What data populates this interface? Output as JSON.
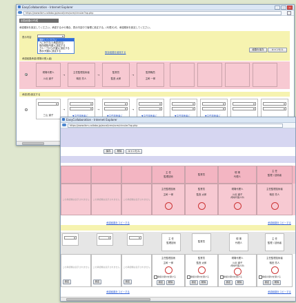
{
  "back_window": {
    "title": "EasyCollaboration - Internet Explorer",
    "url": "https://www.ibm-collabo.jp/ascal/cms/scm/circular?ap.php",
    "section_title": "回覧経路の作成",
    "instruction": "承認順序を設定してください。承認するかの場合、表示内容中で管理に設定する。(代理)も可。承認順序を設定してください。",
    "row_label": "表示内容",
    "dropdown_options": [
      "選択してください",
      "人に対する(1)承認(担当)",
      "既存経路(代替)に設定する",
      "グループから(代替)に設定する",
      "表示(代替)に設定する"
    ],
    "link_existing": "既存経路を使用する",
    "link_copy": "回覧経路を保存(登録)",
    "btn_save": "経路を保存",
    "btn_cancel": "キャンセル",
    "route_header": "承認経路承認(現場の受入者)",
    "route_cells": [
      {
        "line1": "現場代理人",
        "line2": "川北 道子"
      },
      {
        "line1": "主任監理技術者",
        "line2": "鴨田 芳人"
      },
      {
        "line1": "監督員",
        "line2": "監査 太郎"
      },
      {
        "line1": "監督職員",
        "line2": "主幹 一郎"
      }
    ],
    "lower_header": "承認(受)設定する",
    "lower_name": "三山 道子",
    "lower_links": [
      "▼主任技術者に",
      "▼主任技術者に",
      "▼主任技術者に",
      "▼主任技術者に",
      "▼主任技術者に"
    ]
  },
  "front_window": {
    "title": "EasyCollaboration - Internet Explorer",
    "url": "https://www.ibm-collabo.jp/ascal/cms/scm/circular?ap.php",
    "btn_save": "保存",
    "btn_delete": "削除",
    "btn_cancel": "キャンセル",
    "head_cells": [
      {
        "line1": "主 任",
        "line2": "監理技術"
      },
      {
        "line1": "監督員",
        "line2": ""
      },
      {
        "line1": "現 場",
        "line2": "代理人"
      },
      {
        "line1": "主 任",
        "line2": "監理 / 技術者"
      }
    ],
    "pink_empty": "この承認欄は表示されません",
    "pink_cells": [
      {
        "role": "主任監理技術",
        "name": "主幹 一郎",
        "stamp": "主幹"
      },
      {
        "role": "監督員",
        "name": "監査 太郎",
        "stamp": "監査"
      },
      {
        "role": "現場代理人",
        "name": "川北 道子",
        "sub": "(現場代理人印)",
        "stamp": "川北"
      },
      {
        "role": "主任監理技術者",
        "name": "鴨田 芳人",
        "stamp": "鴨田"
      }
    ],
    "link_route": "承認経路をコピーする",
    "lower_empty": "この承認欄は表示されません",
    "lower_btn": "設定",
    "lower_cells": [
      {
        "role": "主任監理技術",
        "name": "主幹 一郎",
        "stamp": "主幹"
      },
      {
        "role": "監督員",
        "name": "監査 太郎",
        "stamp": "監査"
      },
      {
        "role": "現場代理人",
        "name": "川北 道子",
        "sub": "(現場代理人印)",
        "stamp": "川北"
      },
      {
        "role": "主任監理技術者",
        "name": "鴨田 芳人",
        "stamp": "鴨田"
      }
    ],
    "check_label": "承認の受付を受ける",
    "btn_set": "設定",
    "btn_remove": "削除",
    "link_bottom": "承認経路をコピーする"
  }
}
